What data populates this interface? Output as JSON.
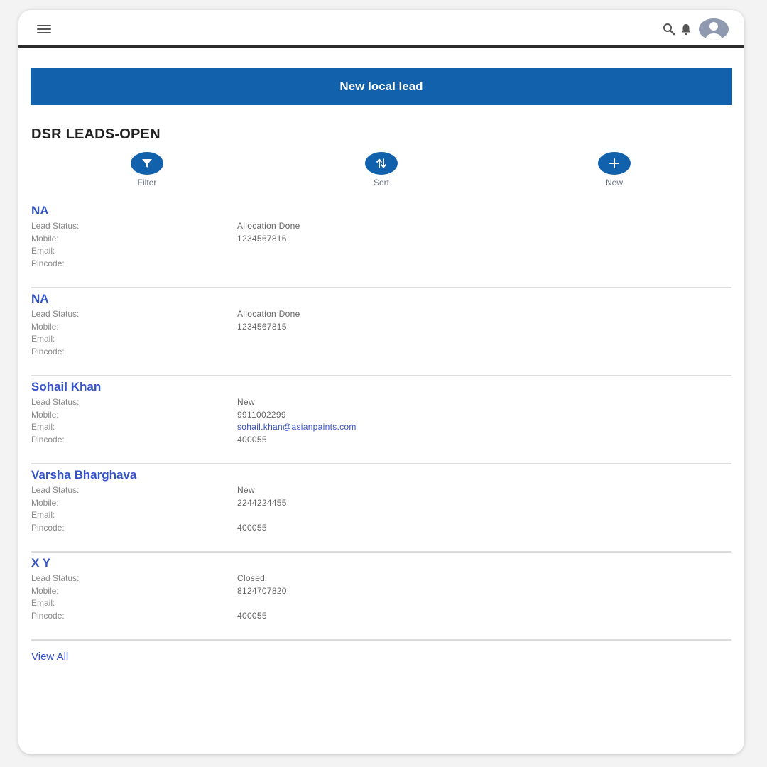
{
  "colors": {
    "brand": "#1261ad",
    "link": "#3553c9"
  },
  "header": {
    "menu_icon": "hamburger-icon",
    "search_icon": "search-icon",
    "bell_icon": "bell-icon",
    "avatar_icon": "user-avatar-icon"
  },
  "new_lead_button": "New local lead",
  "page_title": "DSR LEADS-OPEN",
  "actions": [
    {
      "label": "Filter",
      "icon": "filter-icon"
    },
    {
      "label": "Sort",
      "icon": "sort-icon"
    },
    {
      "label": "New",
      "icon": "plus-icon"
    }
  ],
  "field_labels": {
    "status": "Lead Status:",
    "mobile": "Mobile:",
    "email": "Email:",
    "pincode": "Pincode:"
  },
  "leads": [
    {
      "name": "NA",
      "status": "Allocation Done",
      "mobile": "1234567816",
      "email": "",
      "pincode": ""
    },
    {
      "name": "NA",
      "status": "Allocation Done",
      "mobile": "1234567815",
      "email": "",
      "pincode": ""
    },
    {
      "name": "Sohail Khan",
      "status": "New",
      "mobile": "9911002299",
      "email": "sohail.khan@asianpaints.com",
      "pincode": "400055"
    },
    {
      "name": "Varsha Bharghava",
      "status": "New",
      "mobile": "2244224455",
      "email": "",
      "pincode": "400055"
    },
    {
      "name": "X Y",
      "status": "Closed",
      "mobile": "8124707820",
      "email": "",
      "pincode": "400055"
    }
  ],
  "view_all": "View All"
}
